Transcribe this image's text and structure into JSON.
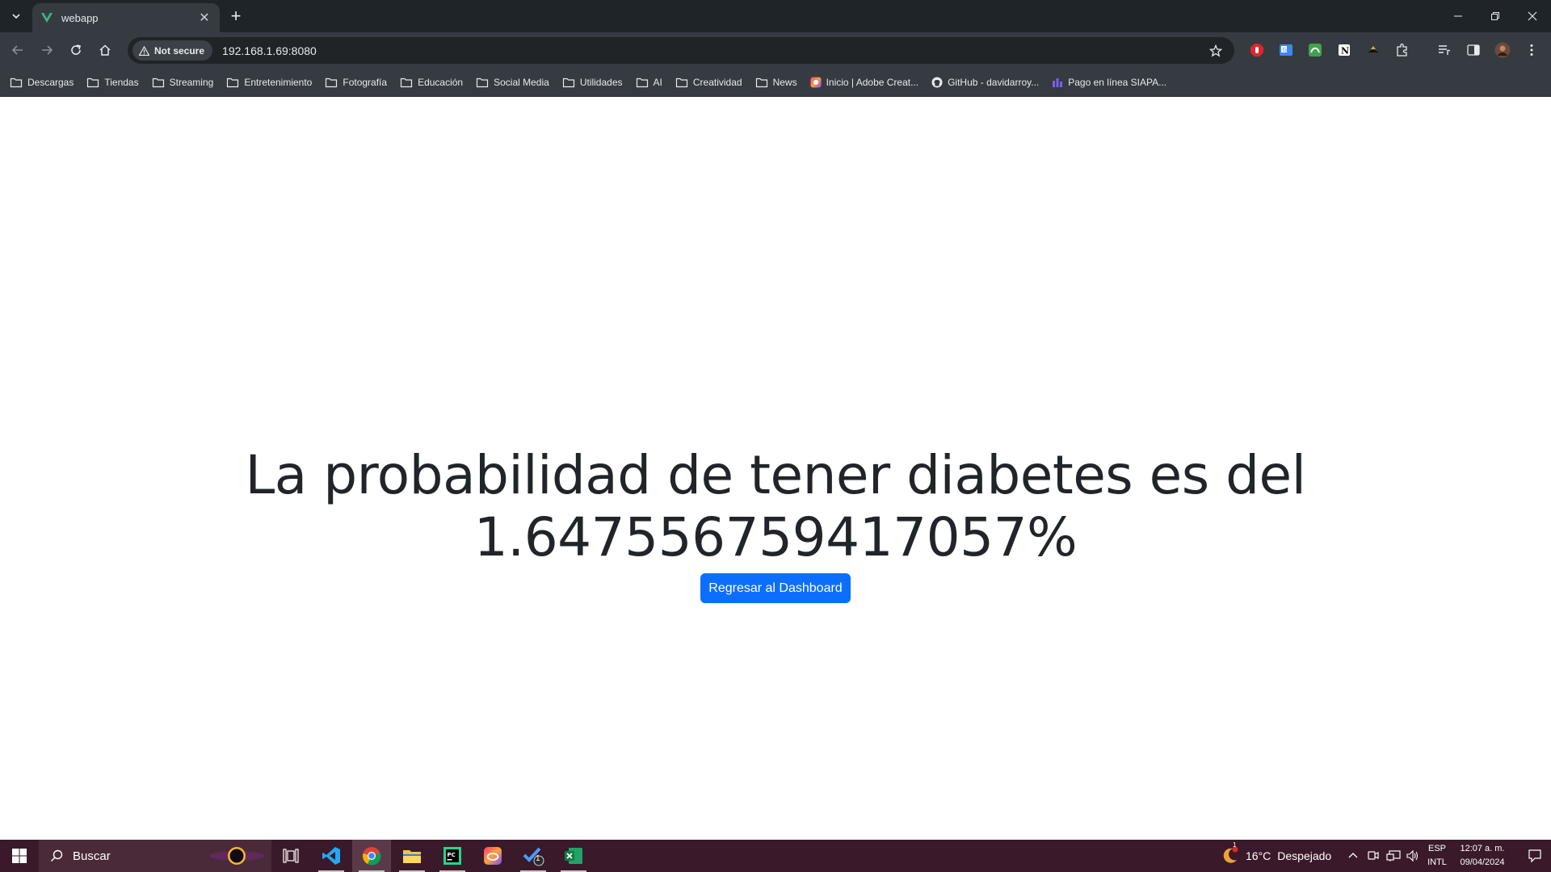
{
  "browser": {
    "tab_title": "webapp",
    "security_label": "Not secure",
    "url": "192.168.1.69:8080"
  },
  "bookmarks": [
    {
      "label": "Descargas",
      "icon": "folder-icon"
    },
    {
      "label": "Tiendas",
      "icon": "folder-icon"
    },
    {
      "label": "Streaming",
      "icon": "folder-icon"
    },
    {
      "label": "Entretenimiento",
      "icon": "folder-icon"
    },
    {
      "label": "Fotografía",
      "icon": "folder-icon"
    },
    {
      "label": "Educación",
      "icon": "folder-icon"
    },
    {
      "label": "Social Media",
      "icon": "folder-icon"
    },
    {
      "label": "Utilidades",
      "icon": "folder-icon"
    },
    {
      "label": "AI",
      "icon": "folder-icon"
    },
    {
      "label": "Creatividad",
      "icon": "folder-icon"
    },
    {
      "label": "News",
      "icon": "folder-icon"
    },
    {
      "label": "Inicio | Adobe Creat...",
      "icon": "adobe-icon"
    },
    {
      "label": "GitHub - davidarroy...",
      "icon": "github-icon"
    },
    {
      "label": "Pago en línea SIAPA...",
      "icon": "siapa-icon"
    }
  ],
  "page": {
    "headline": "La probabilidad de tener diabetes es del 1.647556759417057%",
    "button_label": "Regresar al Dashboard"
  },
  "taskbar": {
    "search_placeholder": "Buscar",
    "weather_temp": "16°C",
    "weather_text": "Despejado",
    "lang_top": "ESP",
    "lang_bottom": "INTL",
    "time": "12:07 a. m.",
    "date": "09/04/2024",
    "todo_badge": "1",
    "weather_badge": "1"
  },
  "colors": {
    "button_bg": "#0d6efd",
    "headline": "#212529",
    "browser_chrome": "#353b41",
    "taskbar_bg": "#3a1a2a"
  }
}
